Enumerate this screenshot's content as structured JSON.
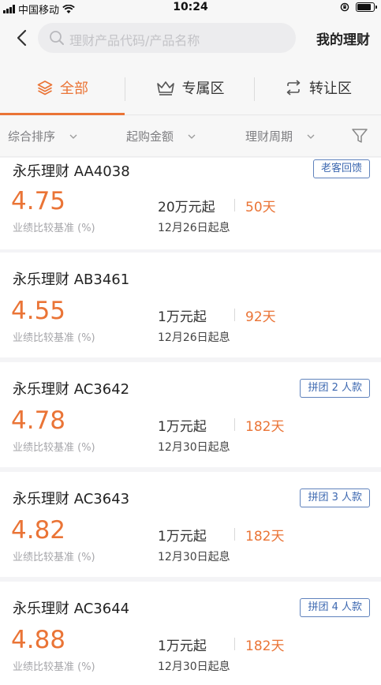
{
  "status_bar": {
    "carrier": "中国移动",
    "time": "10:24",
    "battery_level": 0.85
  },
  "header": {
    "search_placeholder": "理财产品代码/产品名称",
    "my_wealth": "我的理财"
  },
  "tabs": [
    {
      "label": "全部",
      "icon": "layers-icon",
      "active": true
    },
    {
      "label": "专属区",
      "icon": "crown-icon",
      "active": false
    },
    {
      "label": "转让区",
      "icon": "transfer-icon",
      "active": false
    }
  ],
  "filters": [
    {
      "label": "综合排序"
    },
    {
      "label": "起购金额"
    },
    {
      "label": "理财周期"
    }
  ],
  "products": [
    {
      "name": "永乐理财 AA4038",
      "badge": "老客回馈",
      "rate": "4.75",
      "rate_label": "业绩比较基准 (%)",
      "min_amount": "20万元起",
      "term": "50天",
      "start_date": "12月26日起息"
    },
    {
      "name": "永乐理财 AB3461",
      "badge": "",
      "rate": "4.55",
      "rate_label": "业绩比较基准 (%)",
      "min_amount": "1万元起",
      "term": "92天",
      "start_date": "12月26日起息"
    },
    {
      "name": "永乐理财 AC3642",
      "badge": "拼团 2 人款",
      "rate": "4.78",
      "rate_label": "业绩比较基准 (%)",
      "min_amount": "1万元起",
      "term": "182天",
      "start_date": "12月30日起息"
    },
    {
      "name": "永乐理财 AC3643",
      "badge": "拼团 3 人款",
      "rate": "4.82",
      "rate_label": "业绩比较基准 (%)",
      "min_amount": "1万元起",
      "term": "182天",
      "start_date": "12月30日起息"
    },
    {
      "name": "永乐理财 AC3644",
      "badge": "拼团 4 人款",
      "rate": "4.88",
      "rate_label": "业绩比较基准 (%)",
      "min_amount": "1万元起",
      "term": "182天",
      "start_date": "12月30日起息"
    }
  ],
  "colors": {
    "accent": "#ea7436",
    "badge_blue": "#3d68b0"
  }
}
